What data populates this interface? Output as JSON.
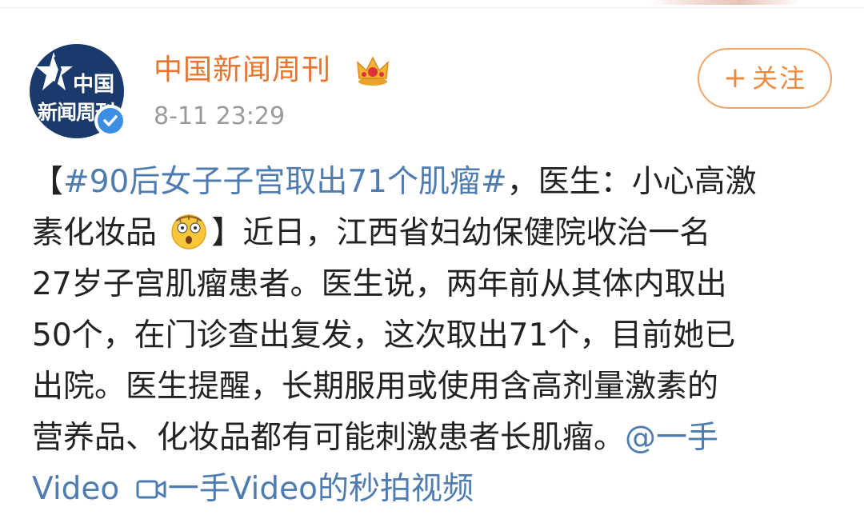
{
  "account": {
    "name": "中国新闻周刊",
    "timestamp": "8-11 23:29",
    "avatar_text_line1": "中国",
    "avatar_text_line2": "新闻周刊"
  },
  "follow_button": {
    "plus": "+",
    "label": "关注"
  },
  "post": {
    "line1_prefix": "【",
    "hashtag": "#90后女子子宫取出71个肌瘤#",
    "line1_rest": "，医生：小心高激",
    "line2_a": "素化妆品",
    "line2_b": "】近日，江西省妇幼保健院收治一名",
    "line3": "27岁子宫肌瘤患者。医生说，两年前从其体内取出",
    "line4": "50个，在门诊查出复发，这次取出71个，目前她已",
    "line5": "出院。医生提醒，长期服用或使用含高剂量激素的",
    "line6_text": "营养品、化妆品都有可能刺激患者长肌瘤。",
    "mention_part1": "@一手",
    "mention_part2": "Video",
    "video_link": "一手Video的秒拍视频"
  },
  "colors": {
    "name": "#e9732a",
    "link": "#4e7bb0",
    "follow_border": "#f2a468",
    "verify_badge": "#3b8ee4",
    "avatar_bg": "#1a3a6b"
  },
  "icons": [
    "crown-icon",
    "verified-icon",
    "shocked-emoji-icon",
    "video-camera-icon",
    "star-logo-icon"
  ]
}
